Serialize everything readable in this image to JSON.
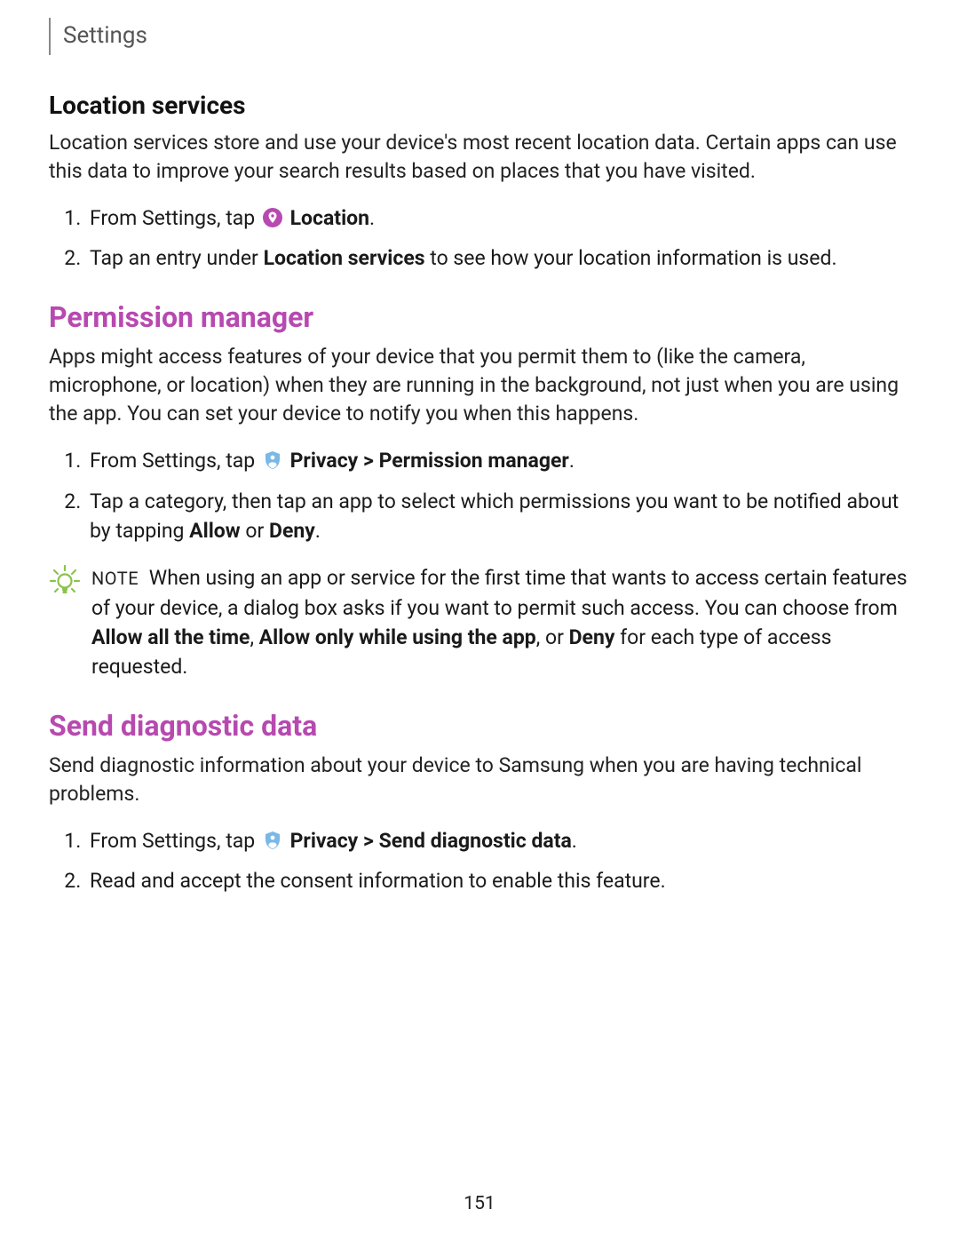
{
  "header": "Settings",
  "location_services": {
    "title": "Location services",
    "intro": "Location services store and use your device's most recent location data. Certain apps can use this data to improve your search results based on places that you have visited.",
    "step1_pre": "From Settings, tap ",
    "step1_bold": "Location",
    "step1_post": ".",
    "step2_pre": "Tap an entry under ",
    "step2_bold": "Location services",
    "step2_post": " to see how your location information is used."
  },
  "permission_manager": {
    "title": "Permission manager",
    "intro": "Apps might access features of your device that you permit them to (like the camera, microphone, or location) when they are running in the background, not just when you are using the app. You can set your device to notify you when this happens.",
    "step1_pre": "From Settings, tap ",
    "step1_bold": "Privacy > Permission manager",
    "step1_post": ".",
    "step2_a": "Tap a category, then tap an app to select which permissions you want to be notified about by tapping ",
    "step2_allow": "Allow",
    "step2_or": " or ",
    "step2_deny": "Deny",
    "step2_post": ".",
    "note_label": "NOTE",
    "note_a": "When using an app or service for the first time that wants to access certain features of your device, a dialog box asks if you want to permit such access. You can choose from ",
    "note_b1": "Allow all the time",
    "note_c1": ", ",
    "note_b2": "Allow only while using the app",
    "note_c2": ", or ",
    "note_b3": "Deny",
    "note_d": " for each type of access requested."
  },
  "send_diag": {
    "title": "Send diagnostic data",
    "intro": "Send diagnostic information about your device to Samsung when you are having technical problems.",
    "step1_pre": "From Settings, tap ",
    "step1_bold": "Privacy > Send diagnostic data",
    "step1_post": ".",
    "step2": "Read and accept the consent information to enable this feature."
  },
  "page_number": "151"
}
